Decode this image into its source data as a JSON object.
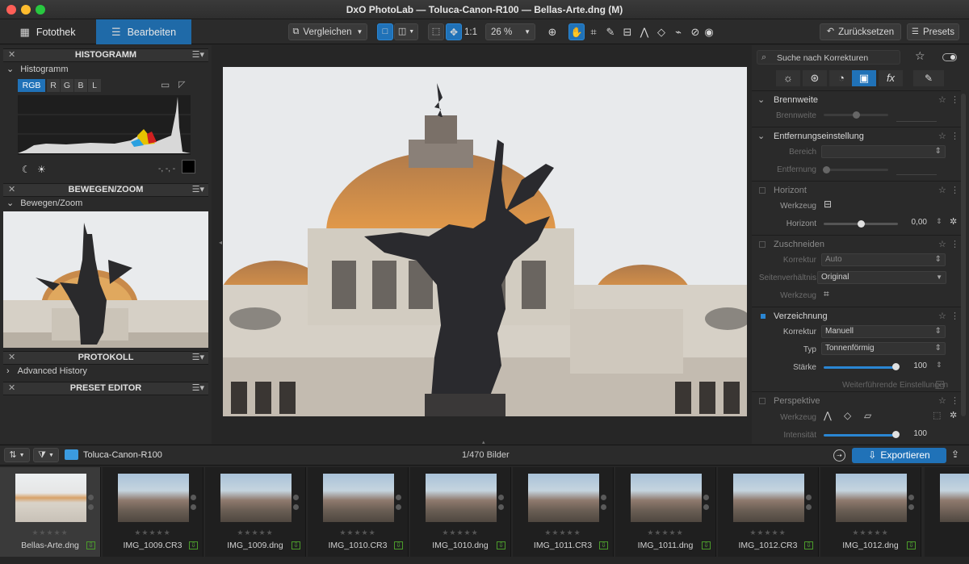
{
  "window": {
    "title": "DxO PhotoLab — Toluca-Canon-R100 — Bellas-Arte.dng (M)"
  },
  "toolbar": {
    "tab_library": "Fotothek",
    "tab_edit": "Bearbeiten",
    "compare_label": "Vergleichen",
    "zoom_one_to_one": "1:1",
    "zoom_percent": "26 %",
    "reset_label": "Zurücksetzen",
    "presets_label": "Presets"
  },
  "left": {
    "histogram": {
      "header": "HISTOGRAMM",
      "sub": "Histogramm",
      "channels": [
        "RGB",
        "R",
        "G",
        "B",
        "L"
      ],
      "pixel_readout": "-, -, -"
    },
    "move_zoom": {
      "header": "BEWEGEN/ZOOM",
      "sub": "Bewegen/Zoom"
    },
    "history": {
      "header": "PROTOKOLL",
      "sub": "Advanced History"
    },
    "preset_editor": {
      "header": "PRESET EDITOR"
    }
  },
  "right": {
    "search_placeholder": "Suche nach Korrekturen",
    "sections": {
      "focal": {
        "title": "Brennweite",
        "label_focal": "Brennweite"
      },
      "distance": {
        "title": "Entfernungseinstellung",
        "label_range": "Bereich",
        "label_distance": "Entfernung"
      },
      "horizon": {
        "title": "Horizont",
        "label_tool": "Werkzeug",
        "label_horizon": "Horizont",
        "value": "0,00"
      },
      "crop": {
        "title": "Zuschneiden",
        "label_correction": "Korrektur",
        "correction_value": "Auto",
        "label_ratio": "Seitenverhältnis",
        "ratio_value": "Original",
        "label_tool": "Werkzeug"
      },
      "distortion": {
        "title": "Verzeichnung",
        "label_correction": "Korrektur",
        "correction_value": "Manuell",
        "label_type": "Typ",
        "type_value": "Tonnenförmig",
        "label_strength": "Stärke",
        "strength_value": "100",
        "advanced": "Weiterführende Einstellungen"
      },
      "perspective": {
        "title": "Perspektive",
        "label_tool": "Werkzeug",
        "label_intensity": "Intensität",
        "intensity_value": "100"
      }
    }
  },
  "filmstrip": {
    "folder": "Toluca-Canon-R100",
    "count": "1/470 Bilder",
    "export_label": "Exportieren",
    "thumbs": [
      "Bellas-Arte.dng",
      "IMG_1009.CR3",
      "IMG_1009.dng",
      "IMG_1010.CR3",
      "IMG_1010.dng",
      "IMG_1011.CR3",
      "IMG_1011.dng",
      "IMG_1012.CR3",
      "IMG_1012.dng"
    ],
    "stars_glyph": "★★★★★"
  },
  "colors": {
    "accent": "#2072b8",
    "background": "#262626",
    "panel": "#2a2a2a"
  }
}
